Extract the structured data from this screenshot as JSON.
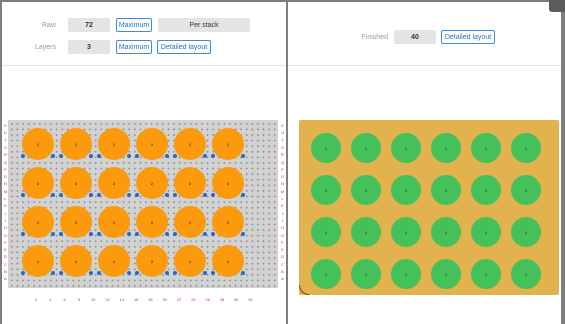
{
  "raw": {
    "label": "Raw",
    "value": "72",
    "maximum_label": "Maximum",
    "per_stack_label": "Per stack"
  },
  "layers": {
    "label": "Layers",
    "value": "3",
    "maximum_label": "Maximum",
    "detailed_layout_label": "Detailed layout"
  },
  "finished": {
    "label": "Finished",
    "value": "40",
    "detailed_layout_label": "Detailed layout"
  },
  "raw_board": {
    "row_letters": [
      "V",
      "U",
      "T",
      "S",
      "R",
      "Q",
      "P",
      "O",
      "N",
      "M",
      "L",
      "K",
      "J",
      "I",
      "H",
      "G",
      "F",
      "E",
      "D",
      "C",
      "B",
      "A"
    ],
    "column_numbers": [
      "2",
      "4",
      "6",
      "8",
      "10",
      "12",
      "14",
      "16",
      "18",
      "20",
      "22",
      "24",
      "26",
      "28",
      "30",
      "32"
    ],
    "circle_labels": [
      [
        "2",
        "2",
        "2",
        "2",
        "2",
        "2"
      ],
      [
        "2",
        "2",
        "2",
        "2",
        "2",
        "2"
      ],
      [
        "2",
        "2",
        "2",
        "2",
        "2",
        "2"
      ],
      [
        "2",
        "2",
        "2",
        "2",
        "2",
        "2"
      ]
    ],
    "circle_color": "#fb9a0d",
    "peg_color": "#2b68c2"
  },
  "finished_board": {
    "circle_labels": [
      [
        "1",
        "1",
        "1",
        "1",
        "1",
        "1"
      ],
      [
        "2",
        "2",
        "2",
        "2",
        "1",
        "1"
      ],
      [
        "2",
        "2",
        "2",
        "2",
        "2",
        "2"
      ],
      [
        "2",
        "2",
        "2",
        "2",
        "2",
        "2"
      ]
    ],
    "circle_color": "#44c15b",
    "board_color": "#e1b24e"
  }
}
